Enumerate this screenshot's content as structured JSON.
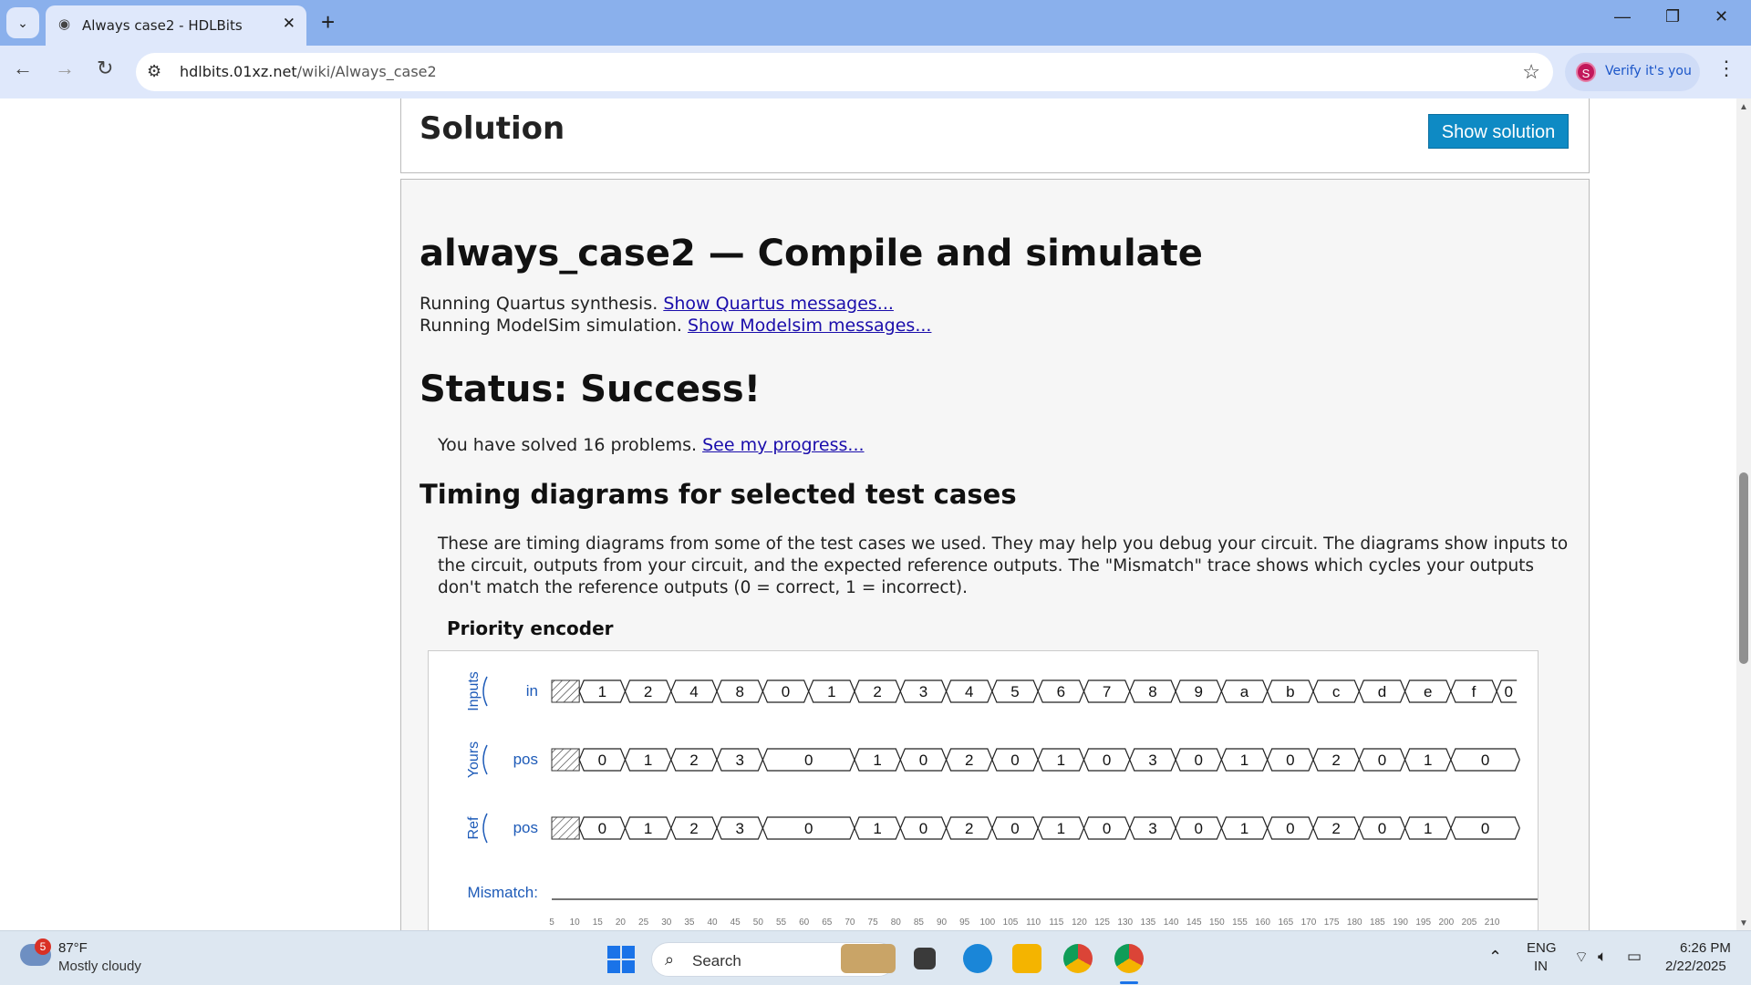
{
  "browser": {
    "tab_title": "Always case2 - HDLBits",
    "url_host": "hdlbits.01xz.net",
    "url_path": "/wiki/Always_case2",
    "profile_initial": "S",
    "profile_label": "Verify it's you"
  },
  "page": {
    "solution_heading": "Solution",
    "show_solution_label": "Show solution",
    "compile_heading": "always_case2 — Compile and simulate",
    "quartus_text": "Running Quartus synthesis.",
    "quartus_link": "Show Quartus messages...",
    "modelsim_text": "Running ModelSim simulation.",
    "modelsim_link": "Show Modelsim messages...",
    "status_heading": "Status: Success!",
    "solved_text": "You have solved 16 problems.",
    "progress_link": "See my progress...",
    "timing_heading": "Timing diagrams for selected test cases",
    "timing_paragraph": "These are timing diagrams from some of the test cases we used. They may help you debug your circuit. The diagrams show inputs to the circuit, outputs from your circuit, and the expected reference outputs. The \"Mismatch\" trace shows which cycles your outputs don't match the reference outputs (0 = correct, 1 = incorrect).",
    "diagram_title": "Priority encoder"
  },
  "timing": {
    "groups": [
      "Inputs",
      "Yours",
      "Ref"
    ],
    "signal_in": "in",
    "signal_pos": "pos",
    "mismatch_label": "Mismatch:",
    "in_values": [
      "1",
      "2",
      "4",
      "8",
      "0",
      "1",
      "2",
      "3",
      "4",
      "5",
      "6",
      "7",
      "8",
      "9",
      "a",
      "b",
      "c",
      "d",
      "e",
      "f",
      "0"
    ],
    "pos_segments": [
      {
        "v": "0",
        "w": 1
      },
      {
        "v": "1",
        "w": 1
      },
      {
        "v": "2",
        "w": 1
      },
      {
        "v": "3",
        "w": 1
      },
      {
        "v": "0",
        "w": 2
      },
      {
        "v": "1",
        "w": 1
      },
      {
        "v": "0",
        "w": 1
      },
      {
        "v": "2",
        "w": 1
      },
      {
        "v": "0",
        "w": 1
      },
      {
        "v": "1",
        "w": 1
      },
      {
        "v": "0",
        "w": 1
      },
      {
        "v": "3",
        "w": 1
      },
      {
        "v": "0",
        "w": 1
      },
      {
        "v": "1",
        "w": 1
      },
      {
        "v": "0",
        "w": 1
      },
      {
        "v": "2",
        "w": 1
      },
      {
        "v": "0",
        "w": 1
      },
      {
        "v": "1",
        "w": 1
      },
      {
        "v": "0",
        "w": 1.5
      }
    ],
    "ticks": [
      "5",
      "10",
      "15",
      "20",
      "25",
      "30",
      "35",
      "40",
      "45",
      "50",
      "55",
      "60",
      "65",
      "70",
      "75",
      "80",
      "85",
      "90",
      "95",
      "100",
      "105",
      "110",
      "115",
      "120",
      "125",
      "130",
      "135",
      "140",
      "145",
      "150",
      "155",
      "160",
      "165",
      "170",
      "175",
      "180",
      "185",
      "190",
      "195",
      "200",
      "205",
      "210"
    ]
  },
  "taskbar": {
    "weather_badge": "5",
    "weather_temp": "87°F",
    "weather_desc": "Mostly cloudy",
    "search_label": "Search",
    "lang_top": "ENG",
    "lang_bottom": "IN",
    "time": "6:26 PM",
    "date": "2/22/2025"
  },
  "colors": {
    "accent": "#0e8ac4",
    "link": "#1a0dab",
    "signal_label": "#1e5bb8"
  }
}
